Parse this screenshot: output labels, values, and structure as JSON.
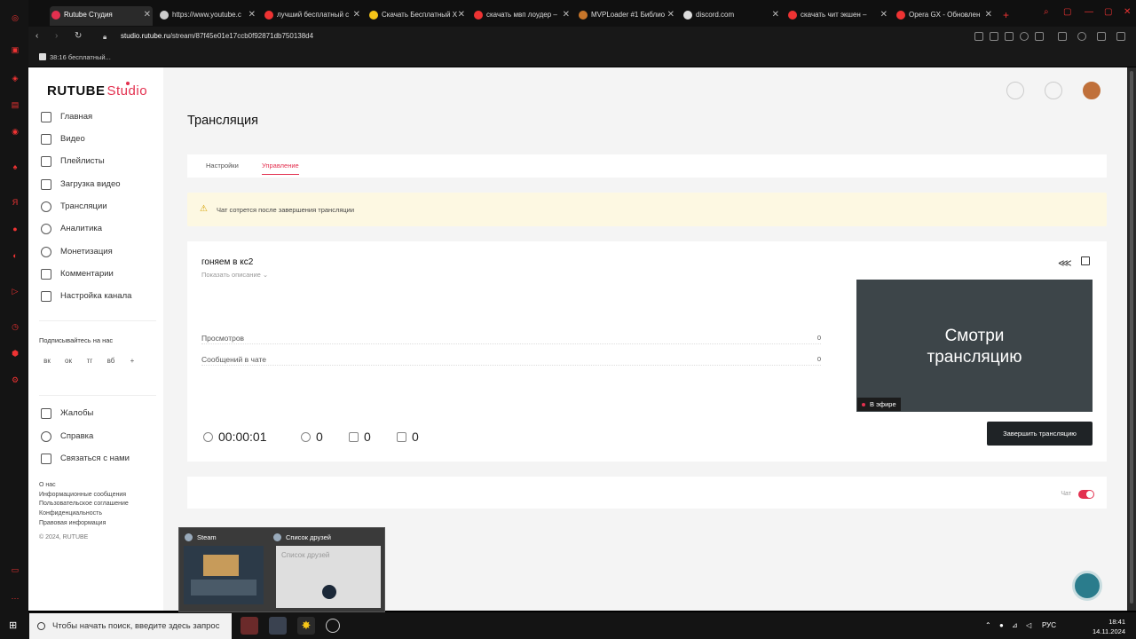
{
  "browser": {
    "tabs": [
      {
        "title": "Rutube Студия",
        "active": true
      },
      {
        "title": "https://www.youtube.c",
        "active": false
      },
      {
        "title": "лучший бесплатный с",
        "active": false
      },
      {
        "title": "Скачать Бесплатный Х",
        "active": false
      },
      {
        "title": "скачать мвп лоудер –",
        "active": false
      },
      {
        "title": "MVPLoader #1 Библио",
        "active": false
      },
      {
        "title": "discord.com",
        "active": false
      },
      {
        "title": "скачать чит экшен –",
        "active": false
      },
      {
        "title": "Opera GX - Обновлен",
        "active": false
      }
    ],
    "new_tab": "+",
    "url_host": "studio.rutube.ru",
    "url_path": "/stream/87f45e01e17ccb0f92871db750138d4",
    "bookmark": "38:16 бесплатный..."
  },
  "sidebar": {
    "logo_main": "RUTUBE",
    "logo_studio": "Studio",
    "items": [
      {
        "label": "Главная"
      },
      {
        "label": "Видео"
      },
      {
        "label": "Плейлисты"
      },
      {
        "label": "Загрузка видео"
      },
      {
        "label": "Трансляции"
      },
      {
        "label": "Аналитика"
      },
      {
        "label": "Монетизация"
      },
      {
        "label": "Комментарии"
      },
      {
        "label": "Настройка канала"
      }
    ],
    "subscribe_label": "Подписывайтесь на нас",
    "social": [
      "вк",
      "ок",
      "тг",
      "вб",
      "+"
    ],
    "bottom_items": [
      {
        "label": "Жалобы"
      },
      {
        "label": "Справка"
      },
      {
        "label": "Связаться с нами"
      }
    ],
    "footer_links": [
      "О нас",
      "Информационные сообщения",
      "Пользовательское соглашение",
      "Конфиденциальность",
      "Правовая информация",
      "© 2024, RUTUBE"
    ]
  },
  "main": {
    "page_title": "Трансляция",
    "tabs": [
      {
        "label": "Настройки",
        "selected": false
      },
      {
        "label": "Управление",
        "selected": true
      }
    ],
    "warning": "Чат сотрется после завершения трансляции",
    "stream": {
      "title": "гоняем в кс2",
      "show_description": "Показать описание ⌄",
      "stats": [
        {
          "label": "Просмотров",
          "value": "0"
        },
        {
          "label": "Сообщений в чате",
          "value": "0"
        }
      ],
      "preview_line1": "Смотри",
      "preview_line2": "трансляцию",
      "live_badge": "В эфире",
      "end_button": "Завершить трансляцию",
      "timer": "00:00:01",
      "viewers": "0",
      "likes": "0",
      "dislikes": "0"
    },
    "chat_label": "Чат"
  },
  "steam_popup": {
    "steam_title": "Steam",
    "friends_title": "Список друзей",
    "friends_placeholder": "Список друзей"
  },
  "taskbar": {
    "search_placeholder": "Чтобы начать поиск, введите здесь запрос",
    "language": "РУС",
    "time": "18:41",
    "date": "14.11.2024"
  },
  "colors": {
    "accent": "#e3304f",
    "warning_bg": "#fdf8e2",
    "dark_button": "#1f2326"
  }
}
